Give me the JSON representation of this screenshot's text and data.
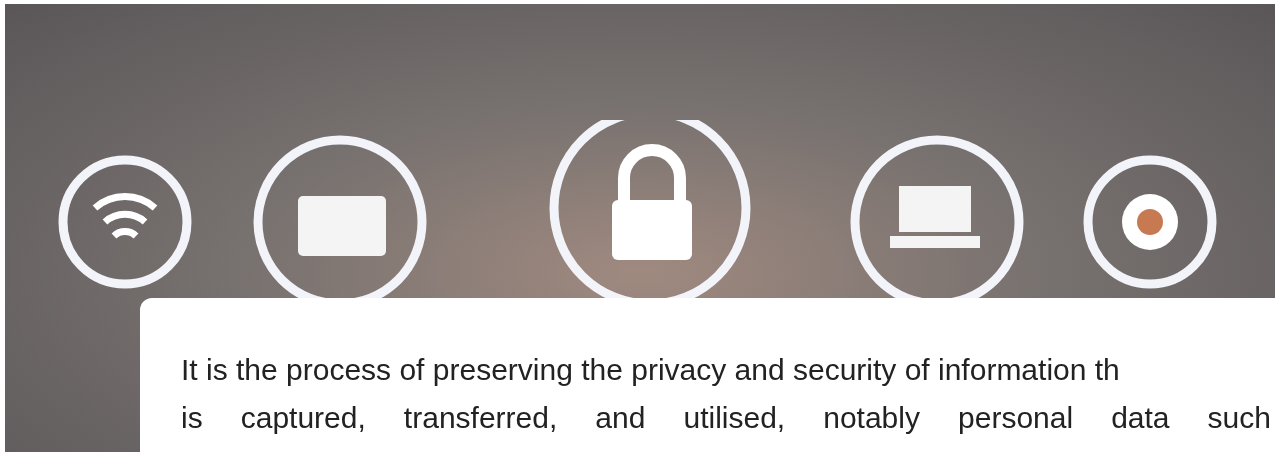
{
  "article": {
    "lines": [
      "It is the process of preserving the privacy and security of information th",
      "is captured, transferred, and utilised, notably personal data such"
    ]
  }
}
